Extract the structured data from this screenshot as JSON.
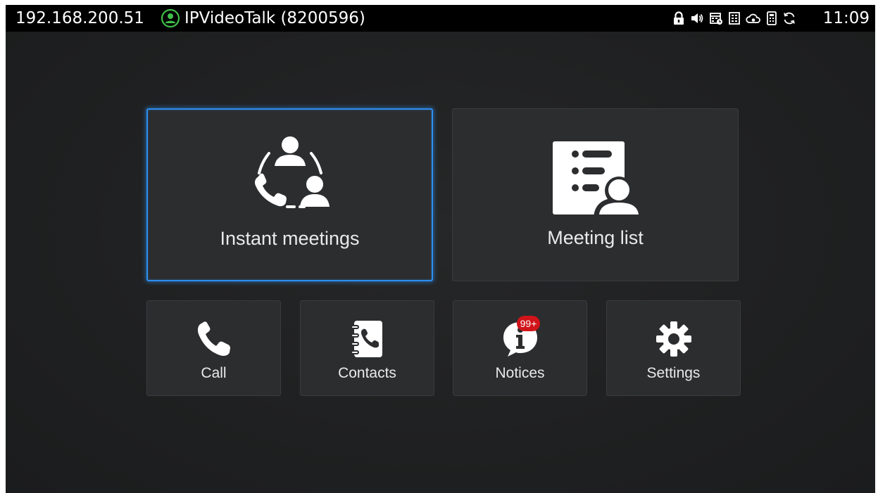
{
  "status_bar": {
    "ip_address": "192.168.200.51",
    "account": "IPVideoTalk (8200596)",
    "account_icon": "account-status-icon",
    "icons": [
      "lock-icon",
      "speaker-icon",
      "calendar-icon",
      "keypad-icon",
      "cloud-icon",
      "remote-icon",
      "sync-icon"
    ],
    "time": "11:09"
  },
  "tiles": {
    "instant_meetings": {
      "label": "Instant meetings",
      "icon": "meeting-people-icon"
    },
    "meeting_list": {
      "label": "Meeting list",
      "icon": "meeting-list-icon"
    },
    "call": {
      "label": "Call",
      "icon": "phone-icon"
    },
    "contacts": {
      "label": "Contacts",
      "icon": "contacts-book-icon"
    },
    "notices": {
      "label": "Notices",
      "icon": "info-bubble-icon",
      "badge": "99+"
    },
    "settings": {
      "label": "Settings",
      "icon": "gear-icon"
    }
  },
  "colors": {
    "focus": "#2e8ff0",
    "tile_background": "#2c2d2f",
    "badge": "#d0141a",
    "status_account": "#3fbf4a"
  }
}
